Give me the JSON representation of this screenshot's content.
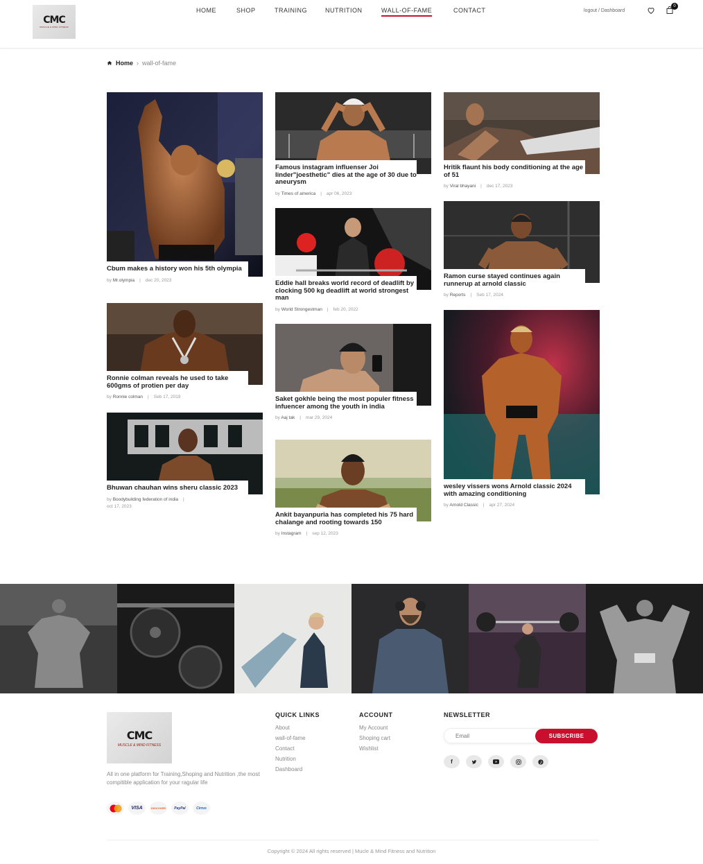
{
  "header": {
    "logo_mark": "CMC",
    "logo_tag": "MUSCLE & MIND FITNESS",
    "nav": [
      "HOME",
      "SHOP",
      "TRAINING",
      "NUTRITION",
      "WALL-OF-FAME",
      "CONTACT"
    ],
    "active_nav": "WALL-OF-FAME",
    "account_links": "logout / Dashboard",
    "cart_count": "0",
    "accent": "#c8102e"
  },
  "breadcrumb": {
    "home": "Home",
    "current": "wall-of-fame"
  },
  "posts": [
    {
      "title": "Cbum makes a history won his 5th olympia",
      "by": "by",
      "author": "Mr.olympia",
      "date": "dec 20, 2023"
    },
    {
      "title": "Ronnie colman reveals he used to take 600gms of protien per day",
      "by": "by",
      "author": "Ronnie colman",
      "date": "Seb 17, 2019"
    },
    {
      "title": "Bhuwan chauhan wins sheru classic 2023",
      "by": "by",
      "author": "Boodybuilding federation of india",
      "date": "oct 17, 2023"
    },
    {
      "title": "Famous instagram influenser Joi linder\"joesthetic\" dies at the age of 30 due to aneurysm",
      "by": "by",
      "author": "Times of america",
      "date": "apr 06, 2023"
    },
    {
      "title": "Eddie hall breaks world record of deadlift by clocking 500 kg deadlift at world strongest man",
      "by": "by",
      "author": "World Strongestman",
      "date": "feb 20, 2022"
    },
    {
      "title": "Saket gokhle being the most populer fitness infuencer among the youth in india",
      "by": "by",
      "author": "Aaj tak",
      "date": "mar 29, 2024"
    },
    {
      "title": "Ankit bayanpuria has completed his 75 hard chalange and rooting towards 150",
      "by": "by",
      "author": "Instagram",
      "date": "sep 12, 2023"
    },
    {
      "title": "Hritik flaunt his body conditioning at the age of 51",
      "by": "by",
      "author": "Viral bhayani",
      "date": "dec 17, 2023"
    },
    {
      "title": "Ramon curse stayed continues again runnerup at arnold classic",
      "by": "by",
      "author": "Reports",
      "date": "Seb 17, 2024"
    },
    {
      "title": "wesley vissers wons Arnold classic 2024 with amazing conditioning",
      "by": "by",
      "author": "Arnold Classic",
      "date": "apr 27, 2024"
    }
  ],
  "footer": {
    "logo_mark": "CMC",
    "logo_tag": "MUSCLE & MIND FITNESS",
    "about": "All in one platform for Training,Shoping and Nutrition ,the most compitible application for your ragular life",
    "payments": [
      "MasterCard",
      "VISA",
      "DISCOVER",
      "PayPal",
      "Cirrus"
    ],
    "quick_links_title": "QUICK LINKS",
    "quick_links": [
      "About",
      "wall-of-fame",
      "Contact",
      "Nutrition",
      "Dashboard"
    ],
    "account_title": "ACCOUNT",
    "account_links": [
      "My Account",
      "Shoping cart",
      "Wishlist"
    ],
    "newsletter_title": "NEWSLETTER",
    "email_placeholder": "Email",
    "subscribe_label": "SUBSCRIBE",
    "socials": [
      "facebook-icon",
      "twitter-icon",
      "youtube-icon",
      "instagram-icon",
      "pinterest-icon"
    ],
    "copyright": "Copyright © 2024 All rights reserved | Mucle & Mind Fitness and Nutrition"
  }
}
